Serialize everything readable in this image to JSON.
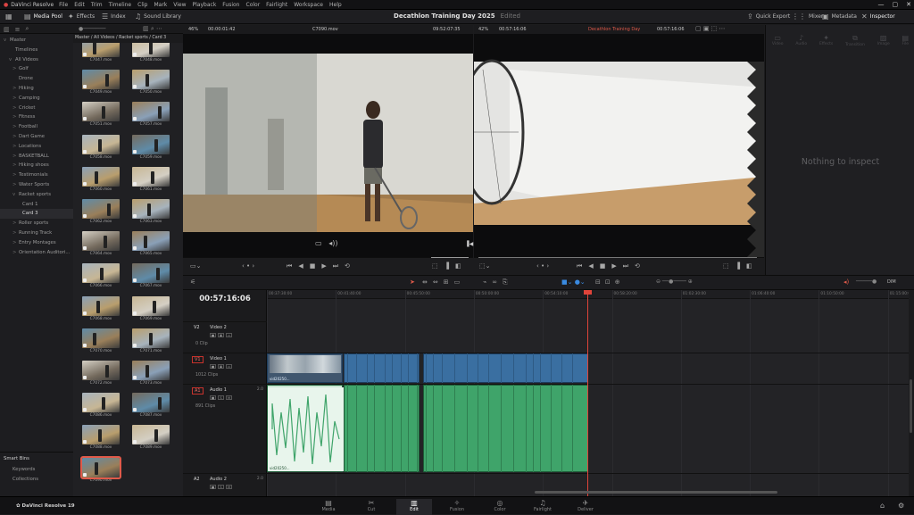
{
  "menu": {
    "app": "DaVinci Resolve",
    "items": [
      "File",
      "Edit",
      "Trim",
      "Timeline",
      "Clip",
      "Mark",
      "View",
      "Playback",
      "Fusion",
      "Color",
      "Fairlight",
      "Workspace",
      "Help"
    ]
  },
  "toolbar": {
    "media_pool": "Media Pool",
    "effects": "Effects",
    "index": "Index",
    "sound_library": "Sound Library",
    "project_title": "Decathlon Training Day 2025",
    "edited": "Edited",
    "quick_export": "Quick Export",
    "mixer": "Mixer",
    "metadata": "Metadata",
    "inspector": "Inspector"
  },
  "bins": {
    "items": [
      {
        "label": "Master",
        "expand": "v"
      },
      {
        "label": "Timelines",
        "expand": ""
      },
      {
        "label": "All Videos",
        "expand": "v"
      },
      {
        "label": "Golf",
        "expand": ">"
      },
      {
        "label": "Drone",
        "expand": ""
      },
      {
        "label": "Hiking",
        "expand": ">"
      },
      {
        "label": "Camping",
        "expand": ">"
      },
      {
        "label": "Cricket",
        "expand": ">"
      },
      {
        "label": "Fitness",
        "expand": ">"
      },
      {
        "label": "Football",
        "expand": ">"
      },
      {
        "label": "Dart Game",
        "expand": ">"
      },
      {
        "label": "Locations",
        "expand": ">"
      },
      {
        "label": "BASKETBALL",
        "expand": ">"
      },
      {
        "label": "Hiking shoes",
        "expand": ">"
      },
      {
        "label": "Testimonials",
        "expand": ">"
      },
      {
        "label": "Water Sports",
        "expand": ">"
      },
      {
        "label": "Racket sports",
        "expand": "v"
      },
      {
        "label": "Card 1",
        "expand": ""
      },
      {
        "label": "Card 3",
        "expand": ""
      },
      {
        "label": "Roller sports",
        "expand": ">"
      },
      {
        "label": "Running Track",
        "expand": ">"
      },
      {
        "label": "Entry Montages",
        "expand": ">"
      },
      {
        "label": "Orientation Auditori...",
        "expand": ">"
      }
    ],
    "smart_bins": "Smart Bins",
    "keywords": "Keywords",
    "collections": "Collections"
  },
  "pool": {
    "path": "Master / All Videos / Racket sports / Card 3",
    "clips": [
      "C7047.mov",
      "C7048.mov",
      "C7049.mov",
      "C7050.mov",
      "C7051.mov",
      "C7057.mov",
      "C7058.mov",
      "C7059.mov",
      "C7060.mov",
      "C7061.mov",
      "C7062.mov",
      "C7063.mov",
      "C7064.mov",
      "C7065.mov",
      "C7066.mov",
      "C7067.mov",
      "C7068.mov",
      "C7069.mov",
      "C7070.mov",
      "C7071.mov",
      "C7072.mov",
      "C7073.mov",
      "C7086.mov",
      "C7087.mov",
      "C7088.mov",
      "C7089.mov",
      "C7090.mov"
    ]
  },
  "viewer_left": {
    "zoom": "46%",
    "timecode": "00:00:01:42",
    "clip": "C7090.mov",
    "end_tc": "09:52:07:35"
  },
  "viewer_right": {
    "zoom": "42%",
    "timecode": "00:57:16:06",
    "timeline": "Decathlon Training Day",
    "end_tc": "00:57:16:06"
  },
  "inspector": {
    "tabs": [
      "Video",
      "Audio",
      "Effects",
      "Transition",
      "Image",
      "File"
    ],
    "empty": "Nothing to inspect"
  },
  "timeline": {
    "timecode": "00:57:16:06",
    "ruler": [
      "00:37:30:00",
      "00:41:40:00",
      "00:45:50:00",
      "00:50:00:00",
      "00:54:10:00",
      "00:58:20:00",
      "01:02:30:00",
      "01:06:40:00",
      "01:10:50:00",
      "01:15:00:00"
    ],
    "tracks": [
      {
        "id": "V2",
        "name": "Video 2",
        "count": "0 Clip"
      },
      {
        "id": "V1",
        "name": "Video 1",
        "count": "1012 Clips"
      },
      {
        "id": "A1",
        "name": "Audio 1",
        "level": "2.0",
        "count": "891 Clips"
      },
      {
        "id": "A2",
        "name": "Audio 2",
        "level": "2.0"
      }
    ],
    "clip_label": "vid20250...",
    "clip_label2": "C7...",
    "dim": "DIM"
  },
  "pages": [
    "Media",
    "Cut",
    "Edit",
    "Fusion",
    "Color",
    "Fairlight",
    "Deliver"
  ],
  "active_page": "Edit",
  "version": "DaVinci Resolve 19",
  "colors": {
    "playhead": "#e0443a",
    "video_clip": "#3a6fa1",
    "audio_clip": "#3fa46a"
  }
}
